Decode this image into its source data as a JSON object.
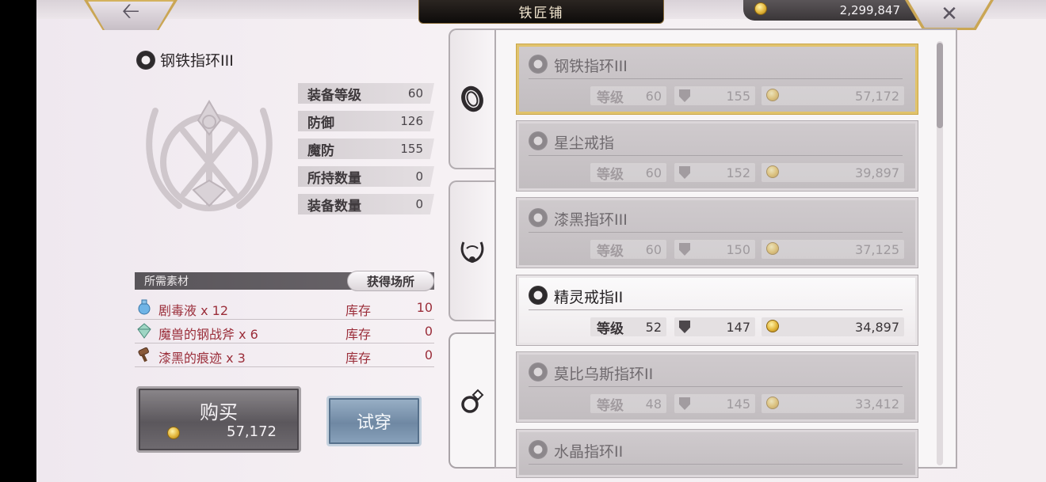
{
  "header": {
    "shop_title": "铁匠铺",
    "back_icon": "left-arrow-icon",
    "close_icon": "close-icon",
    "gold_amount": "2,299,847"
  },
  "detail": {
    "item_name": "钢铁指环III",
    "stats": [
      {
        "label": "装备等级",
        "value": "60"
      },
      {
        "label": "防御",
        "value": "126"
      },
      {
        "label": "魔防",
        "value": "155"
      },
      {
        "label": "所持数量",
        "value": "0"
      },
      {
        "label": "装备数量",
        "value": "0"
      }
    ],
    "materials_header": "所需素材",
    "obtain_button": "获得场所",
    "materials": [
      {
        "name": "剧毒液 x 12",
        "stock_label": "库存",
        "stock": "10",
        "icon": "potion-icon"
      },
      {
        "name": "魔兽的钢战斧 x 6",
        "stock_label": "库存",
        "stock": "0",
        "icon": "crystal-icon"
      },
      {
        "name": "漆黑的痕迹 x 3",
        "stock_label": "库存",
        "stock": "0",
        "icon": "hammer-icon"
      }
    ],
    "buy_button": {
      "label": "购买",
      "price": "57,172"
    },
    "try_button": "试穿"
  },
  "tabs": [
    {
      "icon": "bracelet-icon"
    },
    {
      "icon": "necklace-icon"
    },
    {
      "icon": "ring-icon"
    }
  ],
  "list": {
    "level_label": "等级",
    "items": [
      {
        "name": "钢铁指环III",
        "level": "60",
        "defense": "155",
        "price": "57,172"
      },
      {
        "name": "星尘戒指",
        "level": "60",
        "defense": "152",
        "price": "39,897"
      },
      {
        "name": "漆黑指环III",
        "level": "60",
        "defense": "150",
        "price": "37,125"
      },
      {
        "name": "精灵戒指II",
        "level": "52",
        "defense": "147",
        "price": "34,897"
      },
      {
        "name": "莫比乌斯指环II",
        "level": "48",
        "defense": "145",
        "price": "33,412"
      },
      {
        "name": "水晶指环II",
        "level": "",
        "defense": "",
        "price": ""
      }
    ]
  },
  "colors": {
    "accent_gold": "#caa654",
    "material_red": "#9b2e3a",
    "title_plate": "#1a1614"
  }
}
